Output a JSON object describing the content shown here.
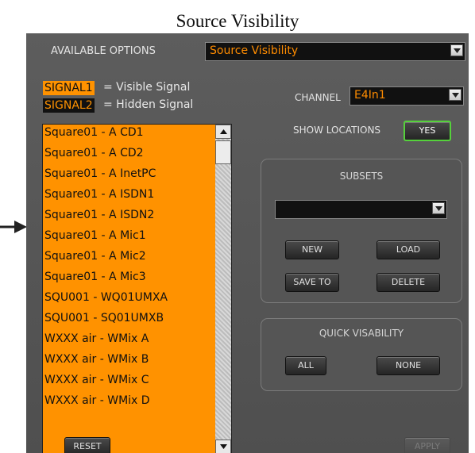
{
  "document_title": "Source Visibility",
  "available_options": {
    "label": "AVAILABLE OPTIONS",
    "value": "Source Visibility"
  },
  "legend": {
    "visible_chip": "SIGNAL1",
    "visible_text": "= Visible Signal",
    "hidden_chip": "SIGNAL2",
    "hidden_text": "= Hidden Signal"
  },
  "channel": {
    "label": "CHANNEL",
    "value": "E4In1"
  },
  "show_locations": {
    "label": "SHOW LOCATIONS",
    "button": "YES"
  },
  "subsets": {
    "title": "SUBSETS",
    "value": "",
    "new": "NEW",
    "load": "LOAD",
    "save_to": "SAVE TO",
    "delete": "DELETE"
  },
  "quick_visibility": {
    "title": "QUICK VISABILITY",
    "all": "ALL",
    "none": "NONE"
  },
  "signals": [
    "Square01 - A CD1",
    "Square01 - A CD2",
    "Square01 - A InetPC",
    "Square01 - A ISDN1",
    "Square01 - A ISDN2",
    "Square01 - A Mic1",
    "Square01 - A Mic2",
    "Square01 - A Mic3",
    "SQU001 - WQ01UMXA",
    "SQU001 - SQ01UMXB",
    "WXXX air - WMix A",
    "WXXX air - WMix B",
    "WXXX air - WMix C",
    "WXXX air - WMix D"
  ],
  "footer": {
    "reset": "RESET",
    "apply": "APPLY"
  },
  "colors": {
    "visible_signal": "#ff9200",
    "hidden_signal": "#111111",
    "panel": "#555555",
    "accent_green": "#55d13b"
  }
}
